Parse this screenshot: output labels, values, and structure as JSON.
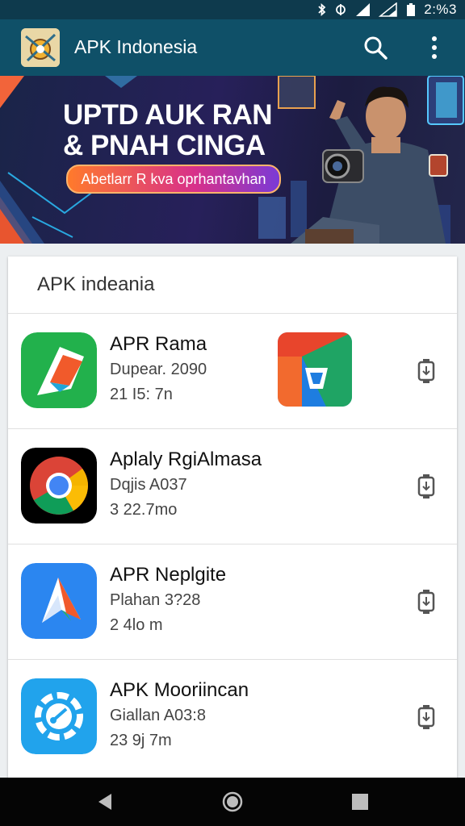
{
  "status_bar": {
    "time": "2:%3",
    "icons": [
      "bluetooth-icon",
      "data-sync-icon",
      "signal-icon",
      "wifi-signal-icon",
      "battery-icon"
    ]
  },
  "app_bar": {
    "title": "APK Indonesia",
    "icons": [
      "search-icon",
      "more-vert-icon"
    ]
  },
  "banner": {
    "title_line1": "UPTD AUK RAN",
    "title_line2": "& PNAH CINGA",
    "button_label": "Abetlarr R kva oprhantavhan"
  },
  "list": {
    "header": "APK indeania",
    "items": [
      {
        "name": "APR Rama",
        "subtitle": "Dupear. 2090",
        "size": "21 I5: 7n",
        "icon": "app-icon-green-arrow",
        "extra_icon": "app-icon-red-blue-tile"
      },
      {
        "name": "Aplaly RgiAlmasa",
        "subtitle": "Dqjis A037",
        "size": "3 22.7mo",
        "icon": "chrome-icon"
      },
      {
        "name": "APR Neplgite",
        "subtitle": "Plahan 3?28",
        "size": "2 4lo m",
        "icon": "app-icon-blue-paper-plane"
      },
      {
        "name": "APK Mooriincan",
        "subtitle": "Giallan A03:8",
        "size": "23 9j 7m",
        "icon": "app-icon-blue-gear"
      }
    ]
  },
  "colors": {
    "status_bar": "#0e3a4d",
    "app_bar": "#0f5068",
    "nav_bar": "#050505",
    "banner_accent": "#ff7a2b"
  },
  "nav_bar": {
    "icons": [
      "back-icon",
      "home-icon",
      "recents-icon"
    ]
  }
}
